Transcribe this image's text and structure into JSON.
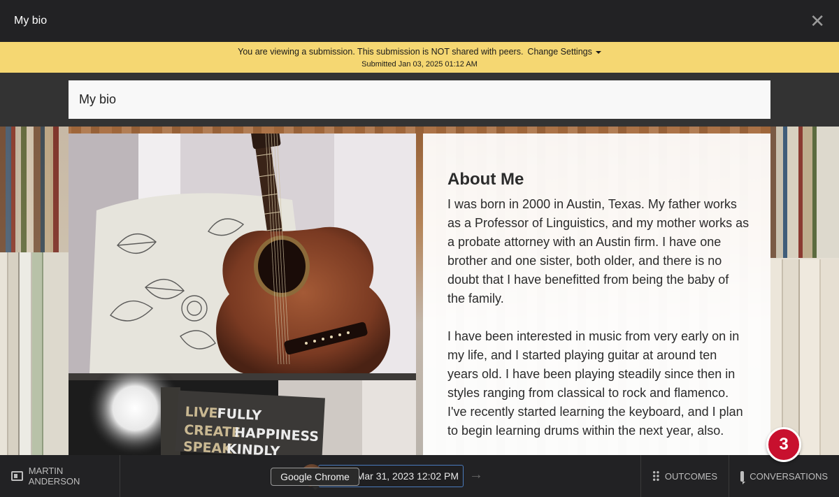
{
  "window": {
    "title": "My bio",
    "close_icon": "close-icon"
  },
  "notice": {
    "message": "You are viewing a submission. This submission is NOT shared with peers.",
    "change_settings_label": "Change Settings",
    "submitted": "Submitted Jan 03, 2025 01:12 AM",
    "background": "#f5d772"
  },
  "page": {
    "title": "My bio"
  },
  "about": {
    "heading": "About Me",
    "paragraph1": "I was born in 2000 in Austin, Texas. My father works as a Professor of Linguistics, and my mother works as a probate attorney with an Austin firm. I have one brother and one sister, both older, and there is no doubt that I have benefitted from being the baby of the family.",
    "paragraph2": "I have been interested in music from very early on in my life, and I started playing guitar at around ten years old. I have been playing steadily since then in styles ranging from classical to rock and flamenco. I've recently started learning the keyboard, and I plan to begin learning drums within the next year, also."
  },
  "quote_image": {
    "lines": [
      [
        "LIVE",
        "FULLY"
      ],
      [
        "CREATE",
        "HAPPINESS"
      ],
      [
        "SPEAK",
        "KINDLY"
      ]
    ]
  },
  "notification_badge": {
    "count": "3",
    "color": "#c8102e"
  },
  "bottom_bar": {
    "student_name": "MARTIN ANDERSON",
    "date_value": "Mar 31, 2023 12:02 PM",
    "outcomes_label": "OUTCOMES",
    "conversations_label": "CONVERSATIONS",
    "tooltip": "Google Chrome"
  }
}
